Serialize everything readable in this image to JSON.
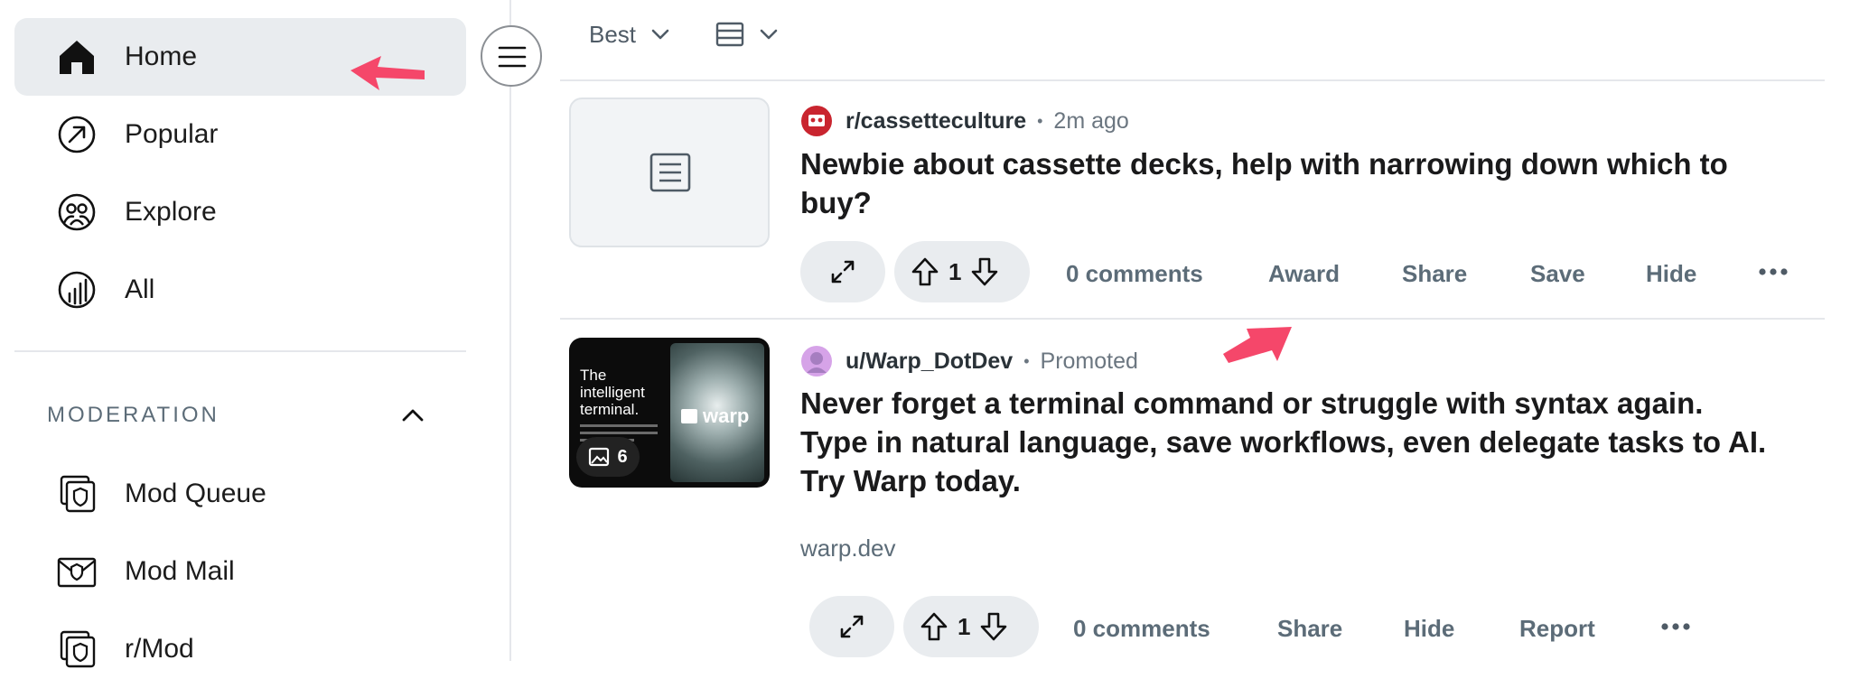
{
  "sidebar": {
    "items": [
      {
        "label": "Home",
        "icon": "home-icon",
        "active": true
      },
      {
        "label": "Popular",
        "icon": "popular-icon"
      },
      {
        "label": "Explore",
        "icon": "explore-icon"
      },
      {
        "label": "All",
        "icon": "all-icon"
      }
    ],
    "moderation": {
      "title": "MODERATION",
      "items": [
        {
          "label": "Mod Queue",
          "icon": "mod-queue-icon"
        },
        {
          "label": "Mod Mail",
          "icon": "mod-mail-icon"
        },
        {
          "label": "r/Mod",
          "icon": "r-mod-icon"
        }
      ]
    }
  },
  "sortbar": {
    "sort_label": "Best",
    "view_icon": "card-view-icon"
  },
  "posts": [
    {
      "community": "r/cassetteculture",
      "time": "2m ago",
      "title_line1": "Newbie about cassette decks, help with narrowing down which to",
      "title_line2": "buy?",
      "votes": "1",
      "actions": {
        "comments": "0 comments",
        "award": "Award",
        "share": "Share",
        "save": "Save",
        "hide": "Hide"
      }
    },
    {
      "community": "u/Warp_DotDev",
      "time": "Promoted",
      "title_line1": "Never forget a terminal command or struggle with syntax again.",
      "title_line2": "Type in natural language, save workflows, even delegate tasks to AI.",
      "title_line3": "Try Warp today.",
      "domain": "warp.dev",
      "votes": "1",
      "ad": {
        "headline_1": "The",
        "headline_2": "intelligent",
        "headline_3": "terminal.",
        "brand": "warp",
        "gallery_count": "6"
      },
      "actions": {
        "comments": "0 comments",
        "share": "Share",
        "hide": "Hide",
        "report": "Report"
      }
    }
  ],
  "colors": {
    "accent_arrow": "#f5476a",
    "active_bg": "#e9ecef",
    "muted": "#5c6c78"
  }
}
